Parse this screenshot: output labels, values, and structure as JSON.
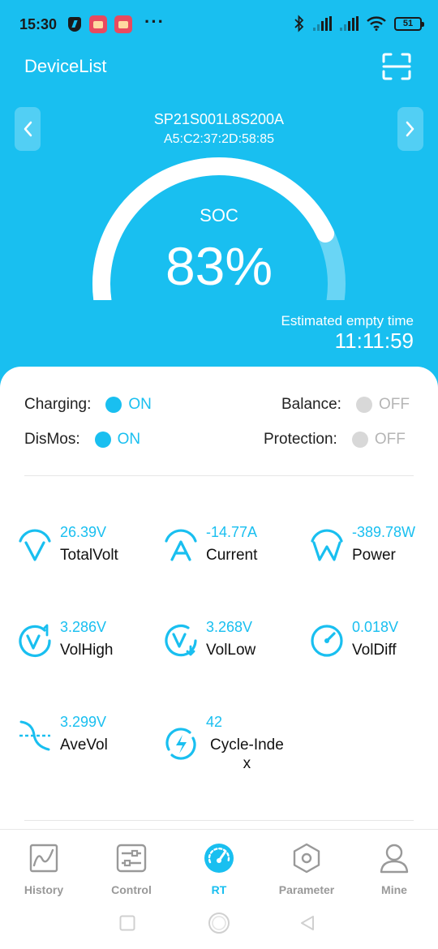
{
  "status_bar": {
    "time": "15:30",
    "dots": "···",
    "battery": "51",
    "icons": [
      "shield-icon",
      "app-icon",
      "app-icon",
      "bluetooth-icon",
      "signal-icon",
      "signal-icon",
      "wifi-icon",
      "battery-icon"
    ]
  },
  "header": {
    "title": "DeviceList",
    "scan_icon": "scan-icon",
    "device_name": "SP21S001L8S200A",
    "device_mac": "A5:C2:37:2D:58:85",
    "colors": {
      "accent": "#19bff0",
      "text": "#ffffff"
    }
  },
  "soc": {
    "label": "SOC",
    "display": "83%",
    "fraction": 0.83,
    "estimated_label": "Estimated empty time",
    "estimated_time": "11:11:59"
  },
  "states": {
    "charging": {
      "label": "Charging:",
      "value": "ON",
      "on": true
    },
    "balance": {
      "label": "Balance:",
      "value": "OFF",
      "on": false
    },
    "dismos": {
      "label": "DisMos:",
      "value": "ON",
      "on": true
    },
    "protection": {
      "label": "Protection:",
      "value": "OFF",
      "on": false
    }
  },
  "metrics": {
    "total_volt": {
      "value": "26.39V",
      "name": "TotalVolt",
      "icon": "voltage-icon"
    },
    "current": {
      "value": "-14.77A",
      "name": "Current",
      "icon": "current-icon"
    },
    "power": {
      "value": "-389.78W",
      "name": "Power",
      "icon": "power-icon"
    },
    "vol_high": {
      "value": "3.286V",
      "name": "VolHigh",
      "icon": "volt-high-icon"
    },
    "vol_low": {
      "value": "3.268V",
      "name": "VolLow",
      "icon": "volt-low-icon"
    },
    "vol_diff": {
      "value": "0.018V",
      "name": "VolDiff",
      "icon": "gauge-icon"
    },
    "ave_vol": {
      "value": "3.299V",
      "name": "AveVol",
      "icon": "average-icon"
    },
    "cycle_index": {
      "value": "42",
      "name": "Cycle-Index",
      "name_line1": "Cycle-Inde",
      "name_line2": "x",
      "icon": "cycle-icon"
    }
  },
  "bottom_nav": {
    "tabs": [
      {
        "label": "History",
        "icon": "history-chart-icon"
      },
      {
        "label": "Control",
        "icon": "sliders-icon"
      },
      {
        "label": "RT",
        "icon": "speedometer-icon",
        "active": true
      },
      {
        "label": "Parameter",
        "icon": "hexagon-icon"
      },
      {
        "label": "Mine",
        "icon": "user-icon"
      }
    ]
  },
  "system_nav": [
    "recent-apps-icon",
    "home-icon",
    "back-icon"
  ]
}
